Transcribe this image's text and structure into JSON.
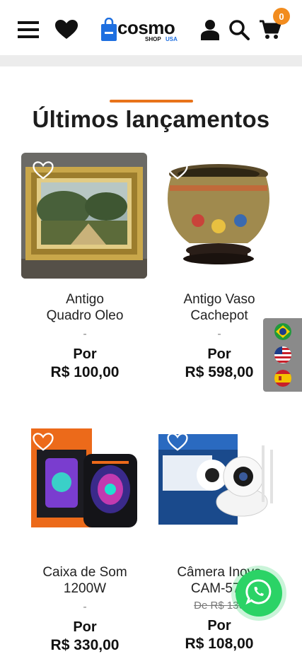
{
  "header": {
    "logo": {
      "brand": "cosmo",
      "sub_shop": "SHOP",
      "sub_usa": "USA"
    },
    "cart_count": "0"
  },
  "section": {
    "title": "Últimos lançamentos"
  },
  "products": [
    {
      "name_line1": "Antigo",
      "name_line2": "Quadro Oleo",
      "dash": "-",
      "por": "Por",
      "price": "R$ 100,00",
      "old_price": ""
    },
    {
      "name_line1": "Antigo Vaso",
      "name_line2": "Cachepot",
      "dash": "-",
      "por": "Por",
      "price": "R$ 598,00",
      "old_price": ""
    },
    {
      "name_line1": "Caixa de Som",
      "name_line2": "1200W",
      "dash": "-",
      "por": "Por",
      "price": "R$ 330,00",
      "old_price": ""
    },
    {
      "name_line1": "Câmera Inova",
      "name_line2": "CAM-570",
      "dash": "",
      "por": "Por",
      "price": "R$ 108,00",
      "old_price": "De R$ 130"
    }
  ],
  "colors": {
    "accent": "#e8731a",
    "whatsapp": "#2bd366",
    "logo_blue": "#1e6fe0"
  },
  "icons": [
    "menu-icon",
    "heart-icon",
    "user-icon",
    "search-icon",
    "cart-icon",
    "whatsapp-icon",
    "flag-brazil-icon",
    "flag-usa-icon",
    "flag-spain-icon"
  ]
}
